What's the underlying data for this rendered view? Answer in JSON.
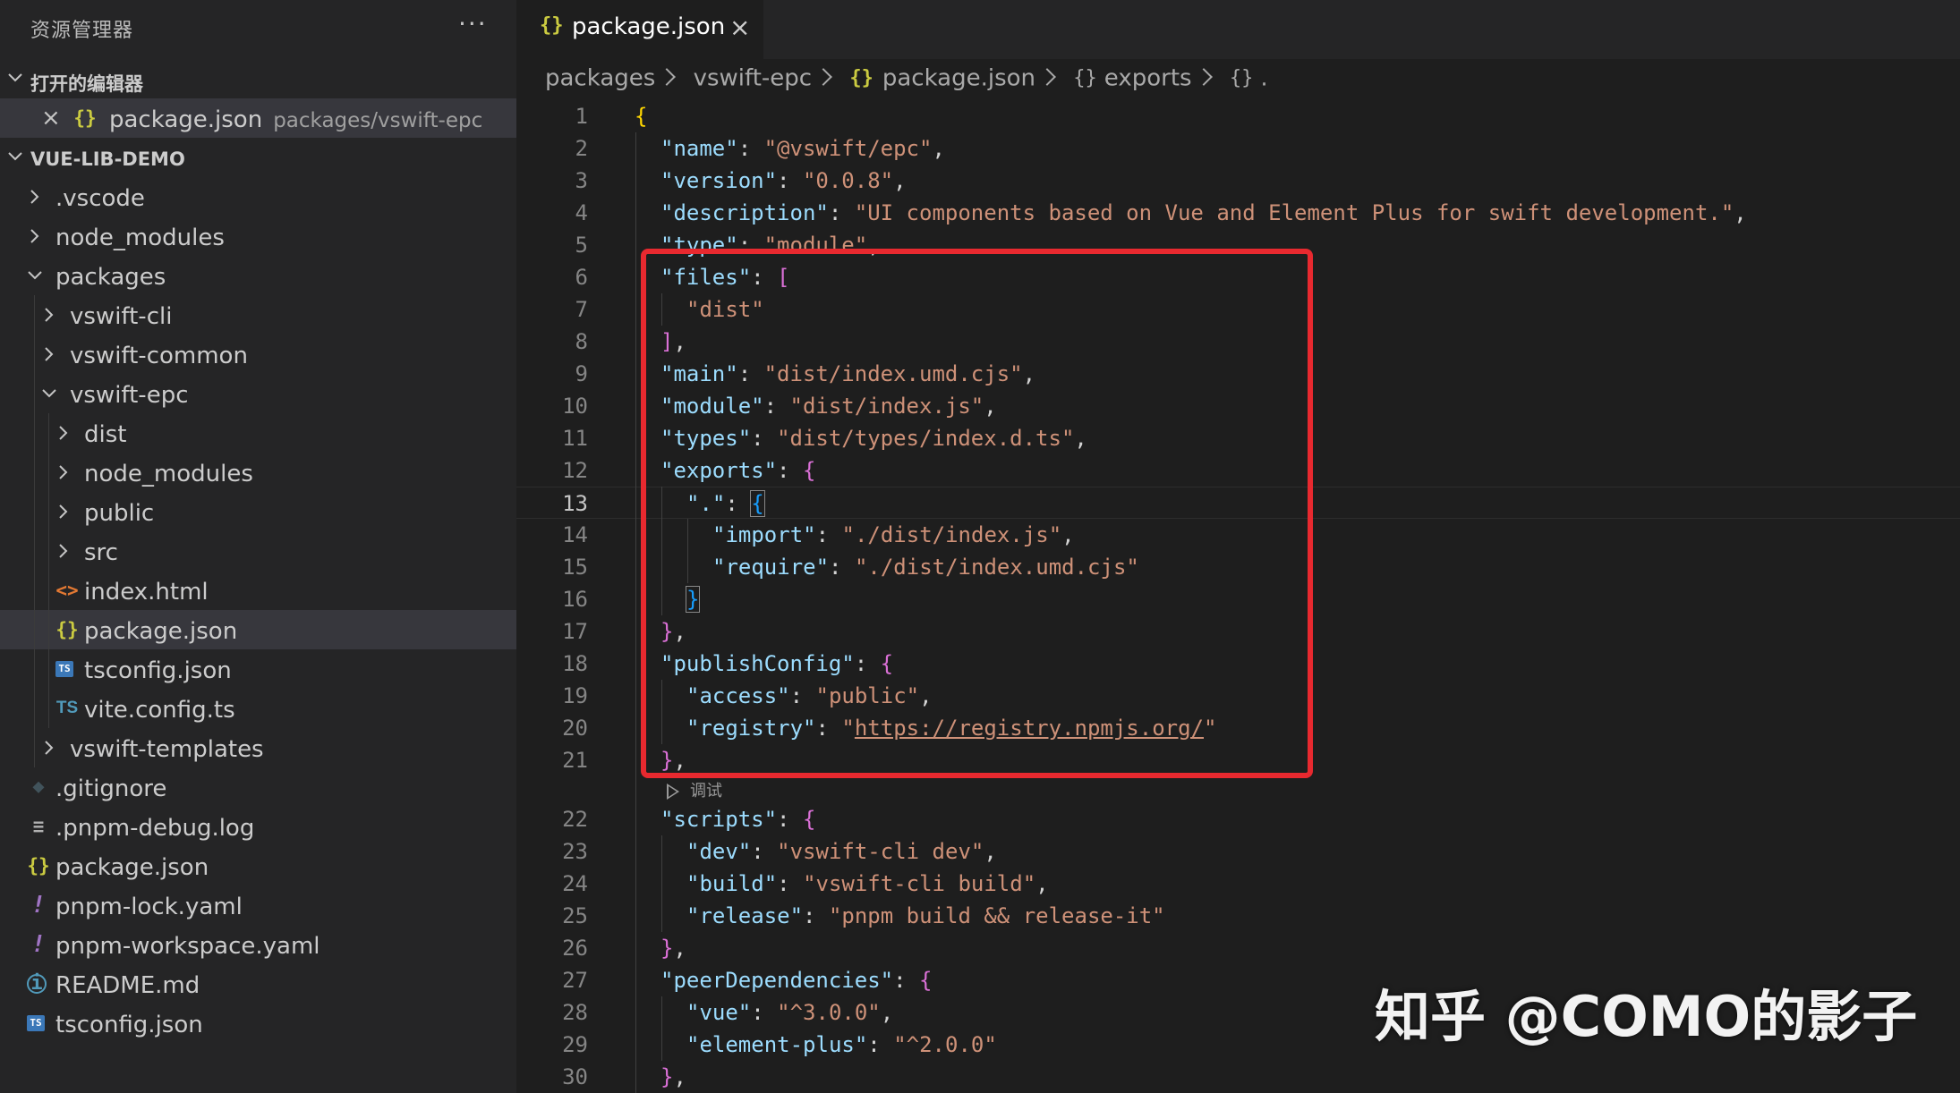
{
  "sidebar": {
    "title": "资源管理器",
    "more": "···",
    "open_editors_label": "打开的编辑器",
    "open_editor": {
      "name": "package.json",
      "path": "packages/vswift-epc"
    },
    "project_label": "VUE-LIB-DEMO",
    "tree": [
      {
        "label": ".vscode",
        "kind": "folder",
        "expanded": false,
        "depth": 1
      },
      {
        "label": "node_modules",
        "kind": "folder",
        "expanded": false,
        "depth": 1
      },
      {
        "label": "packages",
        "kind": "folder",
        "expanded": true,
        "depth": 1
      },
      {
        "label": "vswift-cli",
        "kind": "folder",
        "expanded": false,
        "depth": 2
      },
      {
        "label": "vswift-common",
        "kind": "folder",
        "expanded": false,
        "depth": 2
      },
      {
        "label": "vswift-epc",
        "kind": "folder",
        "expanded": true,
        "depth": 2
      },
      {
        "label": "dist",
        "kind": "folder",
        "expanded": false,
        "depth": 3
      },
      {
        "label": "node_modules",
        "kind": "folder",
        "expanded": false,
        "depth": 3
      },
      {
        "label": "public",
        "kind": "folder",
        "expanded": false,
        "depth": 3
      },
      {
        "label": "src",
        "kind": "folder",
        "expanded": false,
        "depth": 3
      },
      {
        "label": "index.html",
        "kind": "file",
        "icon": "html-icon",
        "depth": 3
      },
      {
        "label": "package.json",
        "kind": "file",
        "icon": "json-icon",
        "depth": 3,
        "selected": true
      },
      {
        "label": "tsconfig.json",
        "kind": "file",
        "icon": "tsconfig-icon",
        "depth": 3
      },
      {
        "label": "vite.config.ts",
        "kind": "file",
        "icon": "typescript-icon",
        "depth": 3
      },
      {
        "label": "vswift-templates",
        "kind": "folder",
        "expanded": false,
        "depth": 2
      },
      {
        "label": ".gitignore",
        "kind": "file",
        "icon": "git-icon",
        "depth": 1
      },
      {
        "label": ".pnpm-debug.log",
        "kind": "file",
        "icon": "log-icon",
        "depth": 1
      },
      {
        "label": "package.json",
        "kind": "file",
        "icon": "json-icon",
        "depth": 1
      },
      {
        "label": "pnpm-lock.yaml",
        "kind": "file",
        "icon": "yaml-icon",
        "depth": 1
      },
      {
        "label": "pnpm-workspace.yaml",
        "kind": "file",
        "icon": "yaml-icon",
        "depth": 1
      },
      {
        "label": "README.md",
        "kind": "file",
        "icon": "info-icon",
        "depth": 1
      },
      {
        "label": "tsconfig.json",
        "kind": "file",
        "icon": "tsconfig-icon",
        "depth": 1
      }
    ]
  },
  "tab": {
    "icon_glyph": "{}",
    "name": "package.json",
    "close": "×"
  },
  "breadcrumb": {
    "items": [
      "packages",
      "vswift-epc",
      "package.json",
      "exports",
      "."
    ]
  },
  "codelens": {
    "label": "调试",
    "after_line": 21
  },
  "current_line": 13,
  "code_lines": [
    {
      "n": "1",
      "indent": 0,
      "tokens": [
        [
          "b1",
          "{"
        ]
      ]
    },
    {
      "n": "2",
      "indent": 1,
      "tokens": [
        [
          "k",
          "\"name\""
        ],
        [
          "p",
          ": "
        ],
        [
          "s",
          "\"@vswift/epc\""
        ],
        [
          "p",
          ","
        ]
      ]
    },
    {
      "n": "3",
      "indent": 1,
      "tokens": [
        [
          "k",
          "\"version\""
        ],
        [
          "p",
          ": "
        ],
        [
          "s",
          "\"0.0.8\""
        ],
        [
          "p",
          ","
        ]
      ]
    },
    {
      "n": "4",
      "indent": 1,
      "tokens": [
        [
          "k",
          "\"description\""
        ],
        [
          "p",
          ": "
        ],
        [
          "s",
          "\"UI components based on Vue and Element Plus for swift development.\""
        ],
        [
          "p",
          ","
        ]
      ]
    },
    {
      "n": "5",
      "indent": 1,
      "tokens": [
        [
          "k",
          "\"type\""
        ],
        [
          "p",
          ": "
        ],
        [
          "s",
          "\"module\""
        ],
        [
          "p",
          ","
        ]
      ]
    },
    {
      "n": "6",
      "indent": 1,
      "tokens": [
        [
          "k",
          "\"files\""
        ],
        [
          "p",
          ": "
        ],
        [
          "b2",
          "["
        ]
      ]
    },
    {
      "n": "7",
      "indent": 2,
      "tokens": [
        [
          "s",
          "\"dist\""
        ]
      ]
    },
    {
      "n": "8",
      "indent": 1,
      "tokens": [
        [
          "b2",
          "]"
        ],
        [
          "p",
          ","
        ]
      ]
    },
    {
      "n": "9",
      "indent": 1,
      "tokens": [
        [
          "k",
          "\"main\""
        ],
        [
          "p",
          ": "
        ],
        [
          "s",
          "\"dist/index.umd.cjs\""
        ],
        [
          "p",
          ","
        ]
      ]
    },
    {
      "n": "10",
      "indent": 1,
      "tokens": [
        [
          "k",
          "\"module\""
        ],
        [
          "p",
          ": "
        ],
        [
          "s",
          "\"dist/index.js\""
        ],
        [
          "p",
          ","
        ]
      ]
    },
    {
      "n": "11",
      "indent": 1,
      "tokens": [
        [
          "k",
          "\"types\""
        ],
        [
          "p",
          ": "
        ],
        [
          "s",
          "\"dist/types/index.d.ts\""
        ],
        [
          "p",
          ","
        ]
      ]
    },
    {
      "n": "12",
      "indent": 1,
      "tokens": [
        [
          "k",
          "\"exports\""
        ],
        [
          "p",
          ": "
        ],
        [
          "b2",
          "{"
        ]
      ]
    },
    {
      "n": "13",
      "indent": 2,
      "tokens": [
        [
          "k",
          "\".\""
        ],
        [
          "p",
          ": "
        ],
        [
          "b3m",
          "{"
        ]
      ]
    },
    {
      "n": "14",
      "indent": 3,
      "tokens": [
        [
          "k",
          "\"import\""
        ],
        [
          "p",
          ": "
        ],
        [
          "s",
          "\"./dist/index.js\""
        ],
        [
          "p",
          ","
        ]
      ]
    },
    {
      "n": "15",
      "indent": 3,
      "tokens": [
        [
          "k",
          "\"require\""
        ],
        [
          "p",
          ": "
        ],
        [
          "s",
          "\"./dist/index.umd.cjs\""
        ]
      ]
    },
    {
      "n": "16",
      "indent": 2,
      "tokens": [
        [
          "b3m",
          "}"
        ]
      ]
    },
    {
      "n": "17",
      "indent": 1,
      "tokens": [
        [
          "b2",
          "}"
        ],
        [
          "p",
          ","
        ]
      ]
    },
    {
      "n": "18",
      "indent": 1,
      "tokens": [
        [
          "k",
          "\"publishConfig\""
        ],
        [
          "p",
          ": "
        ],
        [
          "b2",
          "{"
        ]
      ]
    },
    {
      "n": "19",
      "indent": 2,
      "tokens": [
        [
          "k",
          "\"access\""
        ],
        [
          "p",
          ": "
        ],
        [
          "s",
          "\"public\""
        ],
        [
          "p",
          ","
        ]
      ]
    },
    {
      "n": "20",
      "indent": 2,
      "tokens": [
        [
          "k",
          "\"registry\""
        ],
        [
          "p",
          ": "
        ],
        [
          "s",
          "\""
        ],
        [
          "url",
          "https://registry.npmjs.org/"
        ],
        [
          "s",
          "\""
        ]
      ]
    },
    {
      "n": "21",
      "indent": 1,
      "tokens": [
        [
          "b2",
          "}"
        ],
        [
          "p",
          ","
        ]
      ]
    },
    {
      "n": "22",
      "indent": 1,
      "tokens": [
        [
          "k",
          "\"scripts\""
        ],
        [
          "p",
          ": "
        ],
        [
          "b2",
          "{"
        ]
      ]
    },
    {
      "n": "23",
      "indent": 2,
      "tokens": [
        [
          "k",
          "\"dev\""
        ],
        [
          "p",
          ": "
        ],
        [
          "s",
          "\"vswift-cli dev\""
        ],
        [
          "p",
          ","
        ]
      ]
    },
    {
      "n": "24",
      "indent": 2,
      "tokens": [
        [
          "k",
          "\"build\""
        ],
        [
          "p",
          ": "
        ],
        [
          "s",
          "\"vswift-cli build\""
        ],
        [
          "p",
          ","
        ]
      ]
    },
    {
      "n": "25",
      "indent": 2,
      "tokens": [
        [
          "k",
          "\"release\""
        ],
        [
          "p",
          ": "
        ],
        [
          "s",
          "\"pnpm build && release-it\""
        ]
      ]
    },
    {
      "n": "26",
      "indent": 1,
      "tokens": [
        [
          "b2",
          "}"
        ],
        [
          "p",
          ","
        ]
      ]
    },
    {
      "n": "27",
      "indent": 1,
      "tokens": [
        [
          "k",
          "\"peerDependencies\""
        ],
        [
          "p",
          ": "
        ],
        [
          "b2",
          "{"
        ]
      ]
    },
    {
      "n": "28",
      "indent": 2,
      "tokens": [
        [
          "k",
          "\"vue\""
        ],
        [
          "p",
          ": "
        ],
        [
          "s",
          "\"^3.0.0\""
        ],
        [
          "p",
          ","
        ]
      ]
    },
    {
      "n": "29",
      "indent": 2,
      "tokens": [
        [
          "k",
          "\"element-plus\""
        ],
        [
          "p",
          ": "
        ],
        [
          "s",
          "\"^2.0.0\""
        ]
      ]
    },
    {
      "n": "30",
      "indent": 1,
      "tokens": [
        [
          "b2",
          "}"
        ],
        [
          "p",
          ","
        ]
      ]
    }
  ],
  "watermark": "知乎 @COMO的影子",
  "colors": {
    "highlight_box": "#e8292f",
    "sidebar_bg": "#252526",
    "editor_bg": "#1e1e1e"
  }
}
